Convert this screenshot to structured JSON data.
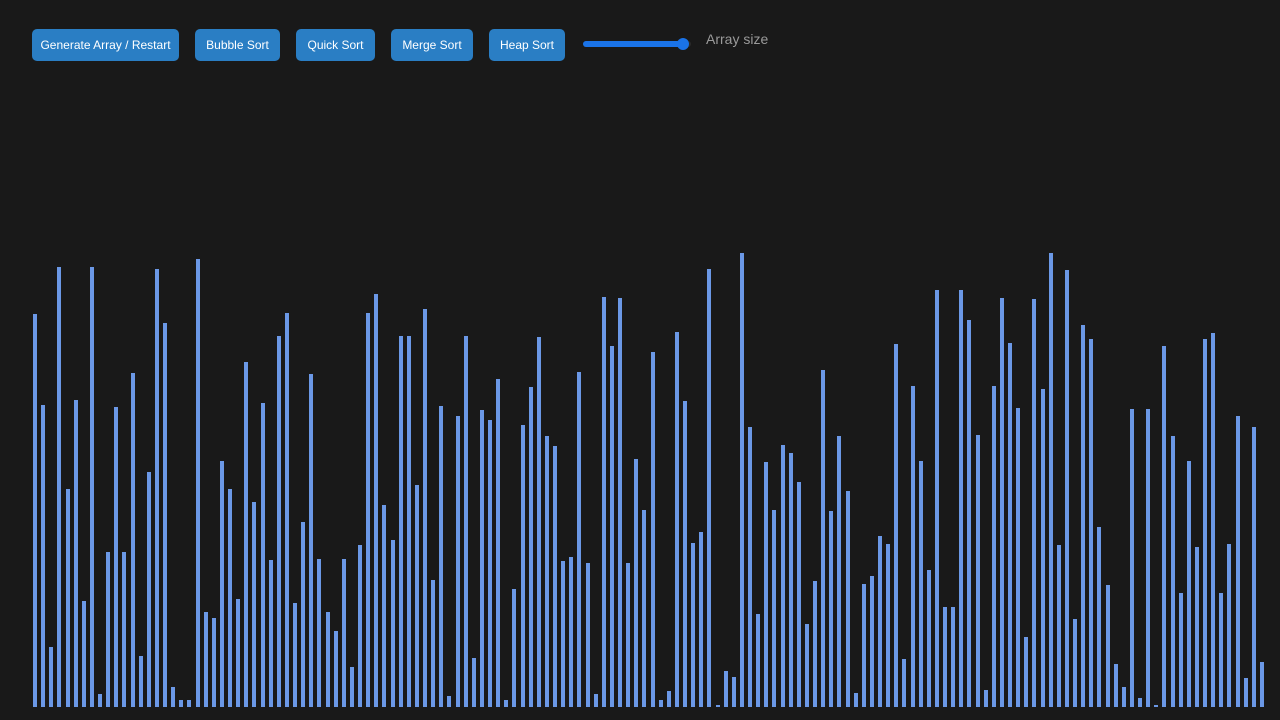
{
  "toolbar": {
    "generate_label": "Generate Array / Restart",
    "bubble_label": "Bubble Sort",
    "quick_label": "Quick Sort",
    "merge_label": "Merge Sort",
    "heap_label": "Heap Sort",
    "slider_label": "Array size",
    "slider_level": 0.93
  },
  "colors": {
    "background": "#191919",
    "button": "#2a7ec4",
    "accent": "#1a73e8",
    "bar": "#6b98e6"
  },
  "array_values": [
    393,
    302,
    60,
    440,
    218,
    307,
    106,
    440,
    13,
    155,
    300,
    155,
    334,
    51,
    235,
    438,
    384,
    20,
    7,
    7,
    448,
    95,
    89,
    246,
    218,
    108,
    345,
    205,
    304,
    147,
    371,
    394,
    104,
    185,
    333,
    148,
    95,
    76,
    148,
    40,
    162,
    394,
    413,
    202,
    167,
    371,
    371,
    222,
    398,
    127,
    301,
    11,
    291,
    371,
    49,
    297,
    287,
    328,
    7,
    118,
    282,
    320,
    370,
    271,
    261,
    146,
    150,
    335,
    144,
    13,
    410,
    361,
    409,
    144,
    248,
    197,
    355,
    7,
    16,
    375,
    306,
    164,
    175,
    438,
    1,
    36,
    30,
    454,
    280,
    93,
    245,
    197,
    262,
    254,
    225,
    83,
    126,
    337,
    196,
    271,
    216,
    14,
    123,
    131,
    171,
    163,
    363,
    48,
    321,
    246,
    137,
    417,
    100,
    100,
    417,
    387,
    272,
    17,
    321,
    409,
    364,
    299,
    70,
    408,
    318,
    454,
    162,
    437,
    88,
    382,
    368,
    180,
    122,
    43,
    20,
    298,
    9,
    298,
    0,
    361,
    271,
    114,
    246,
    160,
    368,
    374,
    114,
    163,
    291,
    29,
    280,
    45
  ]
}
